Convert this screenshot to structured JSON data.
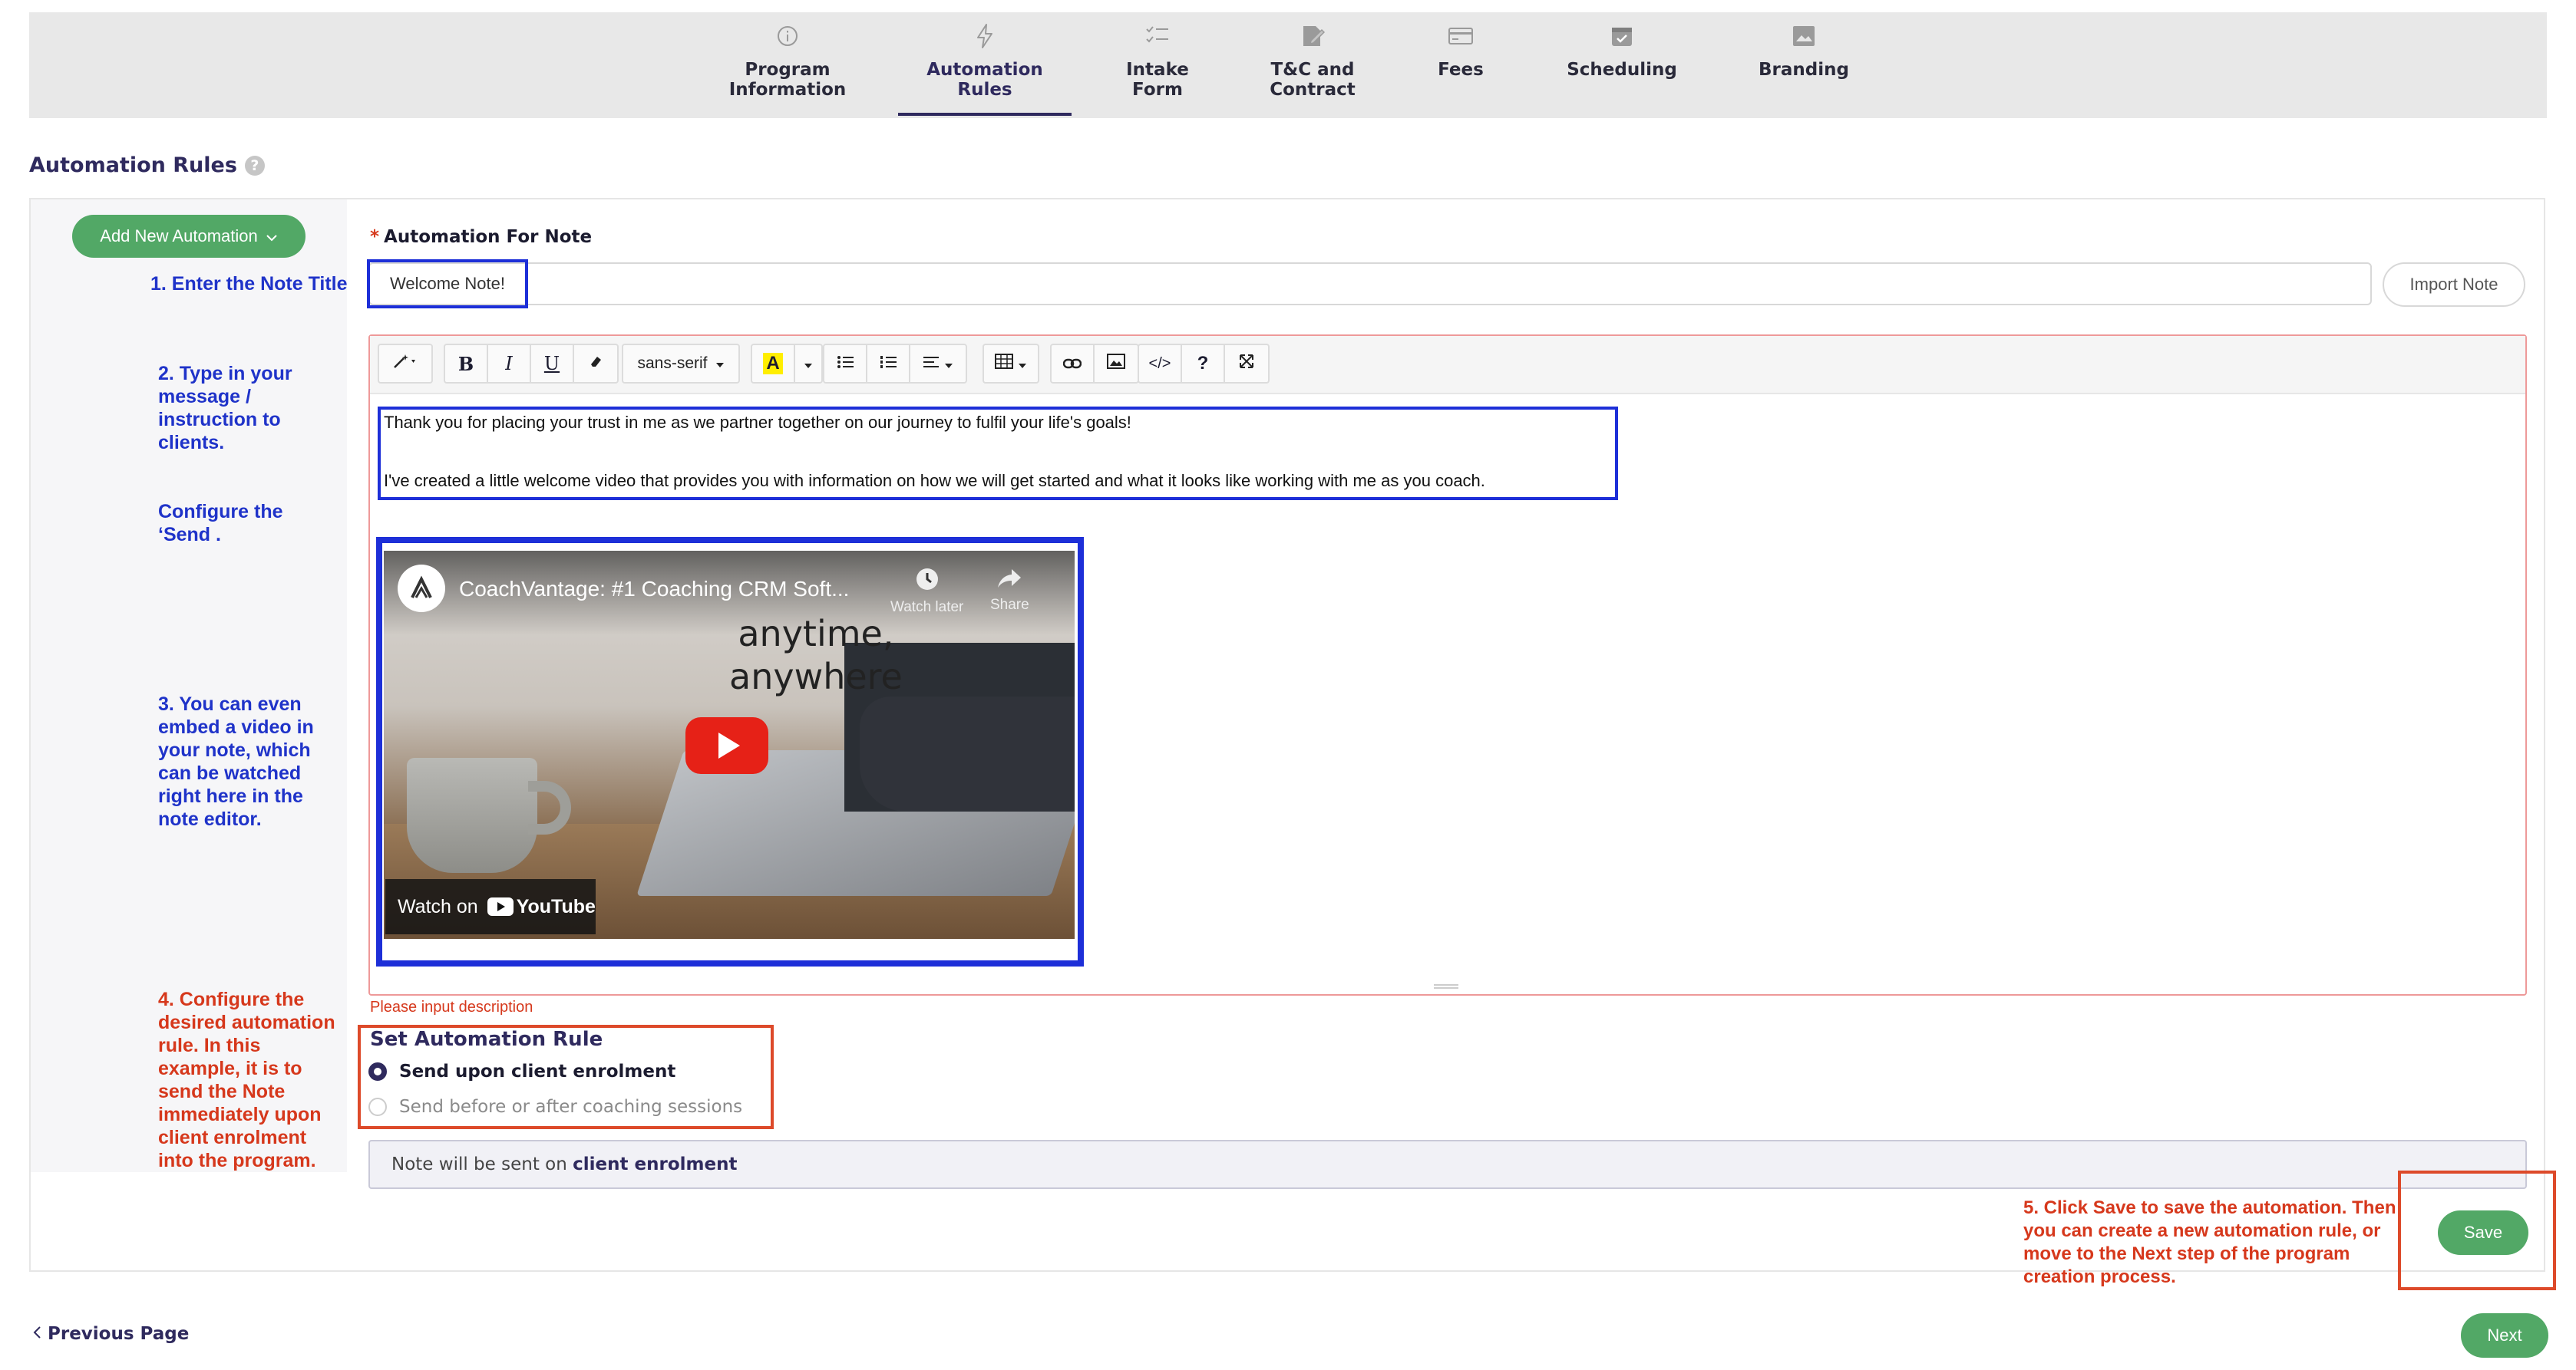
{
  "steps": [
    {
      "label": "Program\nInformation",
      "icon": "info-icon"
    },
    {
      "label": "Automation\nRules",
      "icon": "lightning-icon"
    },
    {
      "label": "Intake\nForm",
      "icon": "checklist-icon"
    },
    {
      "label": "T&C and\nContract",
      "icon": "contract-sign-icon"
    },
    {
      "label": "Fees",
      "icon": "credit-card-icon"
    },
    {
      "label": "Scheduling",
      "icon": "calendar-icon"
    },
    {
      "label": "Branding",
      "icon": "picture-icon"
    }
  ],
  "active_step": "Automation Rules",
  "section_title": "Automation Rules",
  "help_glyph": "?",
  "add_button": "Add New Automation",
  "annotations": {
    "step1": "1. Enter the Note Title",
    "step2a": "2. Type in your message / instruction to clients.",
    "step2b": "Configure the ‘Send .",
    "step3": "3. You can even embed a video in your note, which can be watched right here in the note editor.",
    "step4": "4. Configure the desired automation rule. In this example, it is to send the Note immediately upon client enrolment into the program.",
    "step5": "5. Click Save to save the automation. Then you can create a new automation rule, or move to the Next step of the program creation process."
  },
  "field_label": "Automation For Note",
  "required_mark": "*",
  "note_title_value": "Welcome Note!",
  "import_button": "Import Note",
  "toolbar": {
    "font_name": "sans-serif",
    "bold": "B",
    "italic": "I",
    "underline": "U",
    "font_color_letter": "A",
    "code": "</>",
    "help": "?"
  },
  "editor_lines": [
    "Thank you for placing your trust in me as we partner together on our journey to fulfil your life's goals!",
    "I've created a little welcome video that provides you with information on how we will get started and what it looks like working with me as you coach."
  ],
  "video": {
    "title": "CoachVantage: #1 Coaching CRM Soft...",
    "watch_later": "Watch later",
    "share": "Share",
    "overlay_text": "anytime,\nanywhere",
    "watch_on": "Watch on",
    "youtube": "YouTube"
  },
  "hint_text": "Please input description",
  "rule_title": "Set Automation Rule",
  "rule_options": [
    {
      "label": "Send upon client enrolment",
      "selected": true
    },
    {
      "label": "Send before or after coaching sessions",
      "selected": false
    }
  ],
  "summary_prefix": "Note will be sent on",
  "summary_value": "client enrolment",
  "save_button": "Save",
  "prev_page": "Previous Page",
  "next_button": "Next",
  "colors": {
    "accent_green": "#52a866",
    "brand_navy": "#2f2a5e",
    "annotation_blue": "#1f33c9",
    "annotation_red": "#d6381c",
    "highlight_blue": "#1d2fd8",
    "youtube_red": "#e62117"
  }
}
